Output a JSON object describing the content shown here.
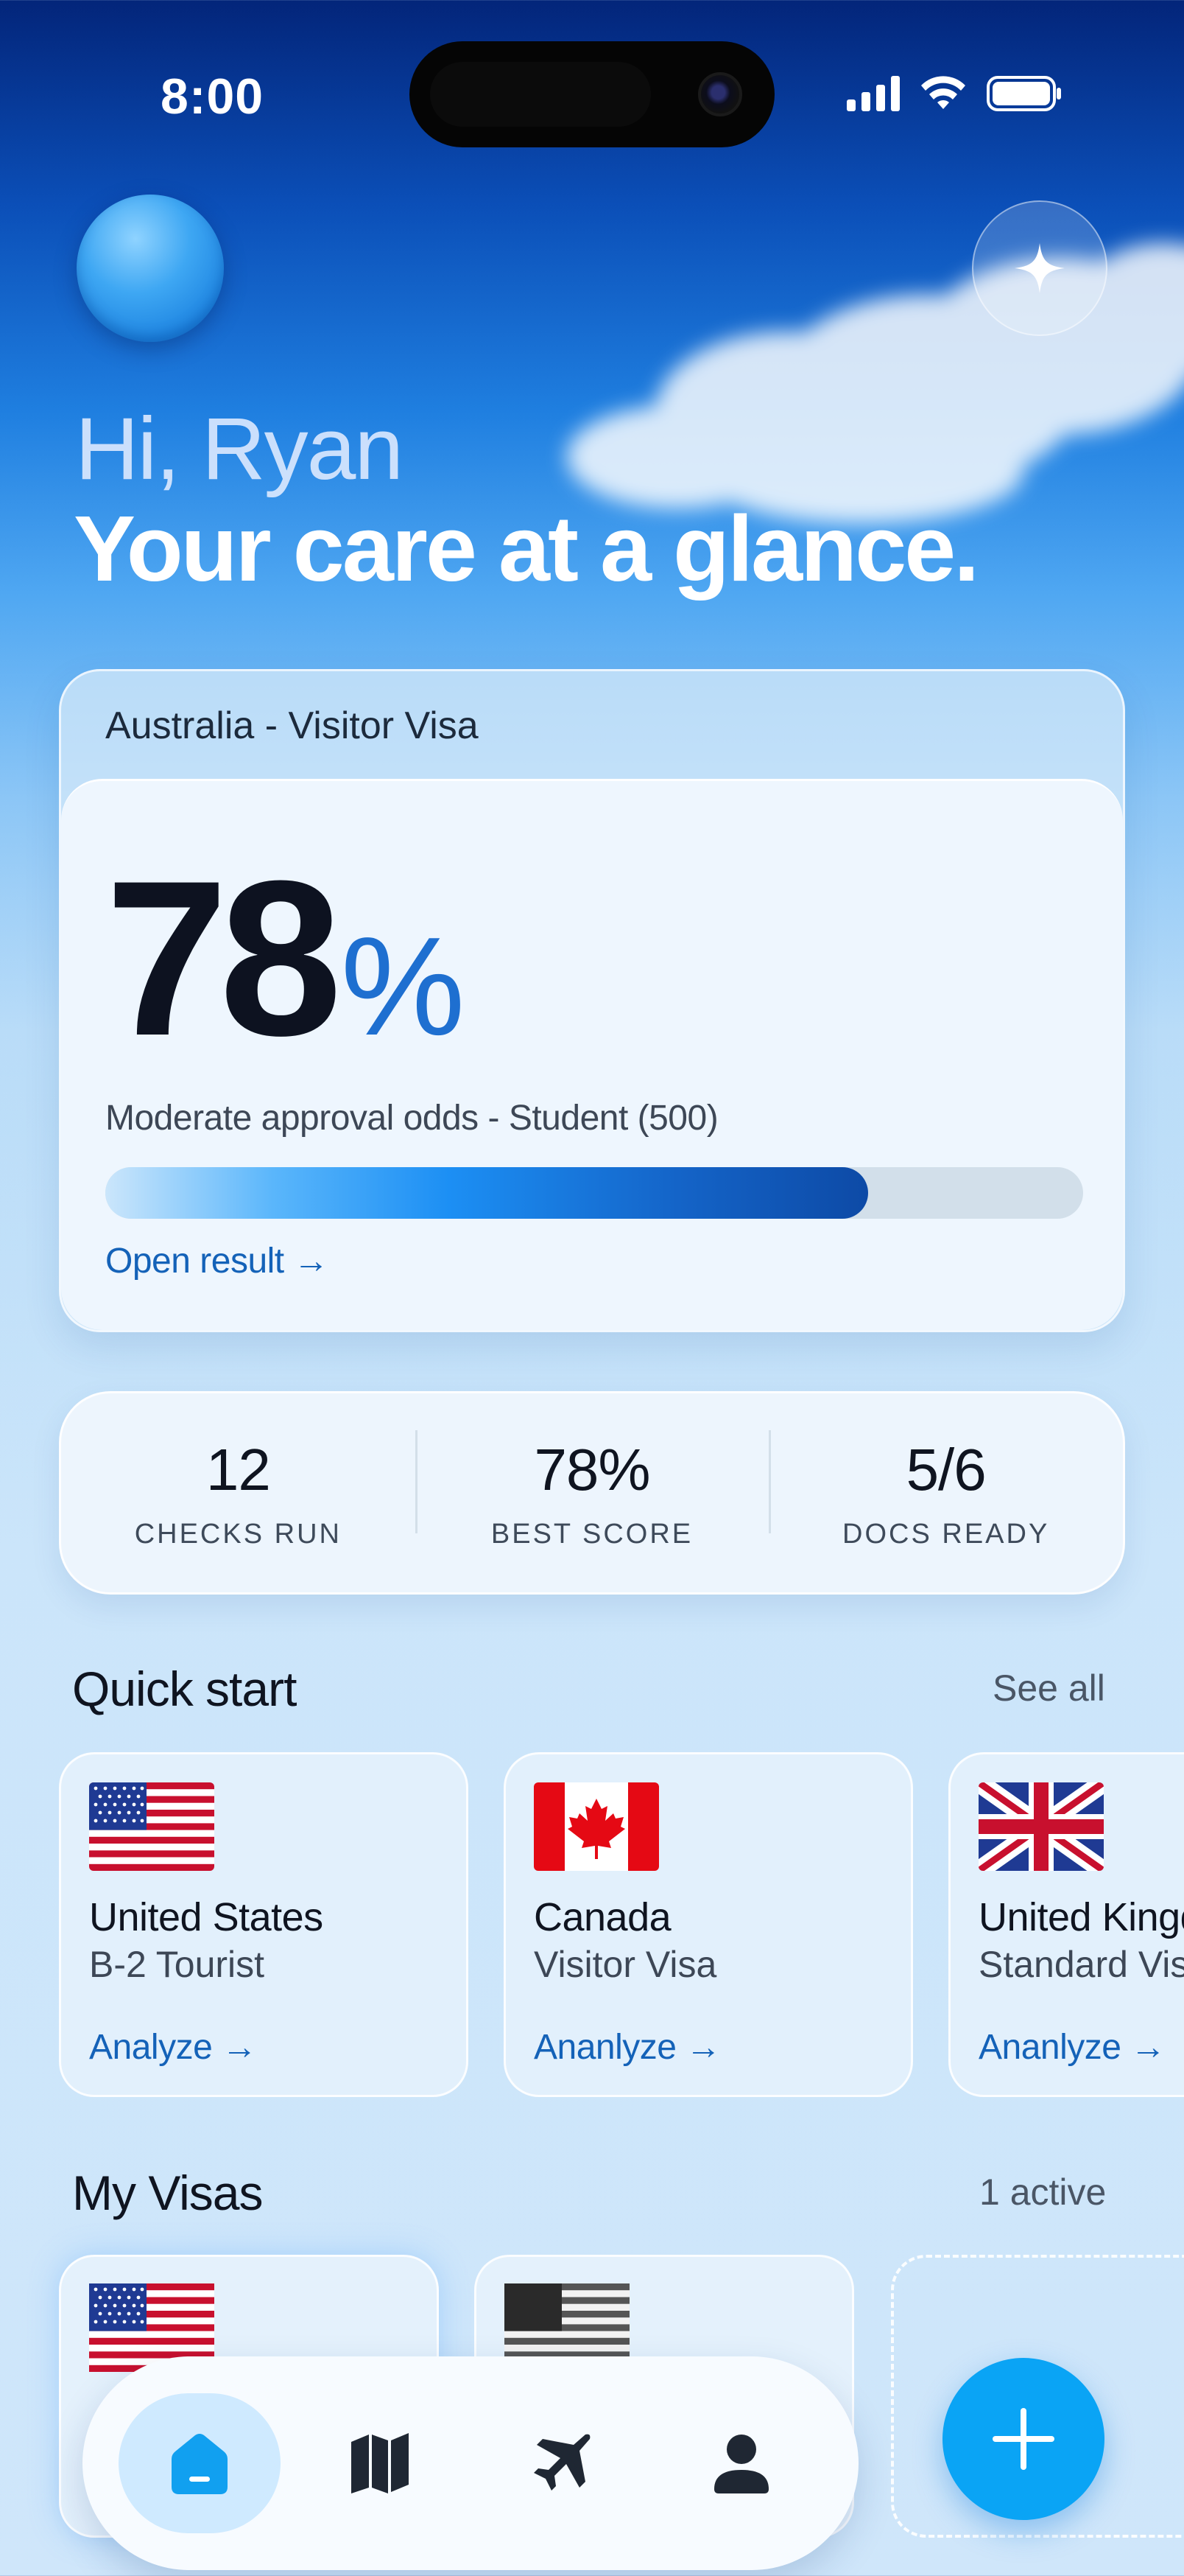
{
  "status_bar": {
    "time": "8:00"
  },
  "header": {
    "greeting": "Hi, Ryan",
    "headline": "Your care at a glance."
  },
  "main_card": {
    "country": "Australia -  Visitor Visa",
    "percent_value": "78",
    "percent_symbol": "%",
    "odds_text": "Moderate approval odds - Student (500)",
    "progress": 0.78,
    "link_label": "Open result →"
  },
  "stats": [
    {
      "value": "12",
      "label": "CHECKS RUN"
    },
    {
      "value": "78%",
      "label": "BEST SCORE"
    },
    {
      "value": "5/6",
      "label": "DOCS READY"
    }
  ],
  "quick_start": {
    "title": "Quick start",
    "link": "See all",
    "cards": [
      {
        "country": "United States",
        "visa": "B-2 Tourist",
        "action": "Analyze →",
        "flag": "us-flag"
      },
      {
        "country": "Canada",
        "visa": "Visitor Visa",
        "action": "Ananlyze →",
        "flag": "canada-flag"
      },
      {
        "country": "United Kingdom",
        "visa": "Standard Visitor",
        "action": "Ananlyze →",
        "flag": "uk-flag"
      }
    ]
  },
  "my_visas": {
    "title": "My Visas",
    "status": "1 active"
  },
  "nav": {
    "items": [
      "home-icon",
      "map-icon",
      "plane-icon",
      "profile-icon"
    ],
    "active": "home-icon"
  },
  "colors": {
    "accent": "#1462b8",
    "fab": "#0aa4f5",
    "percent": "#1e6fd0"
  }
}
